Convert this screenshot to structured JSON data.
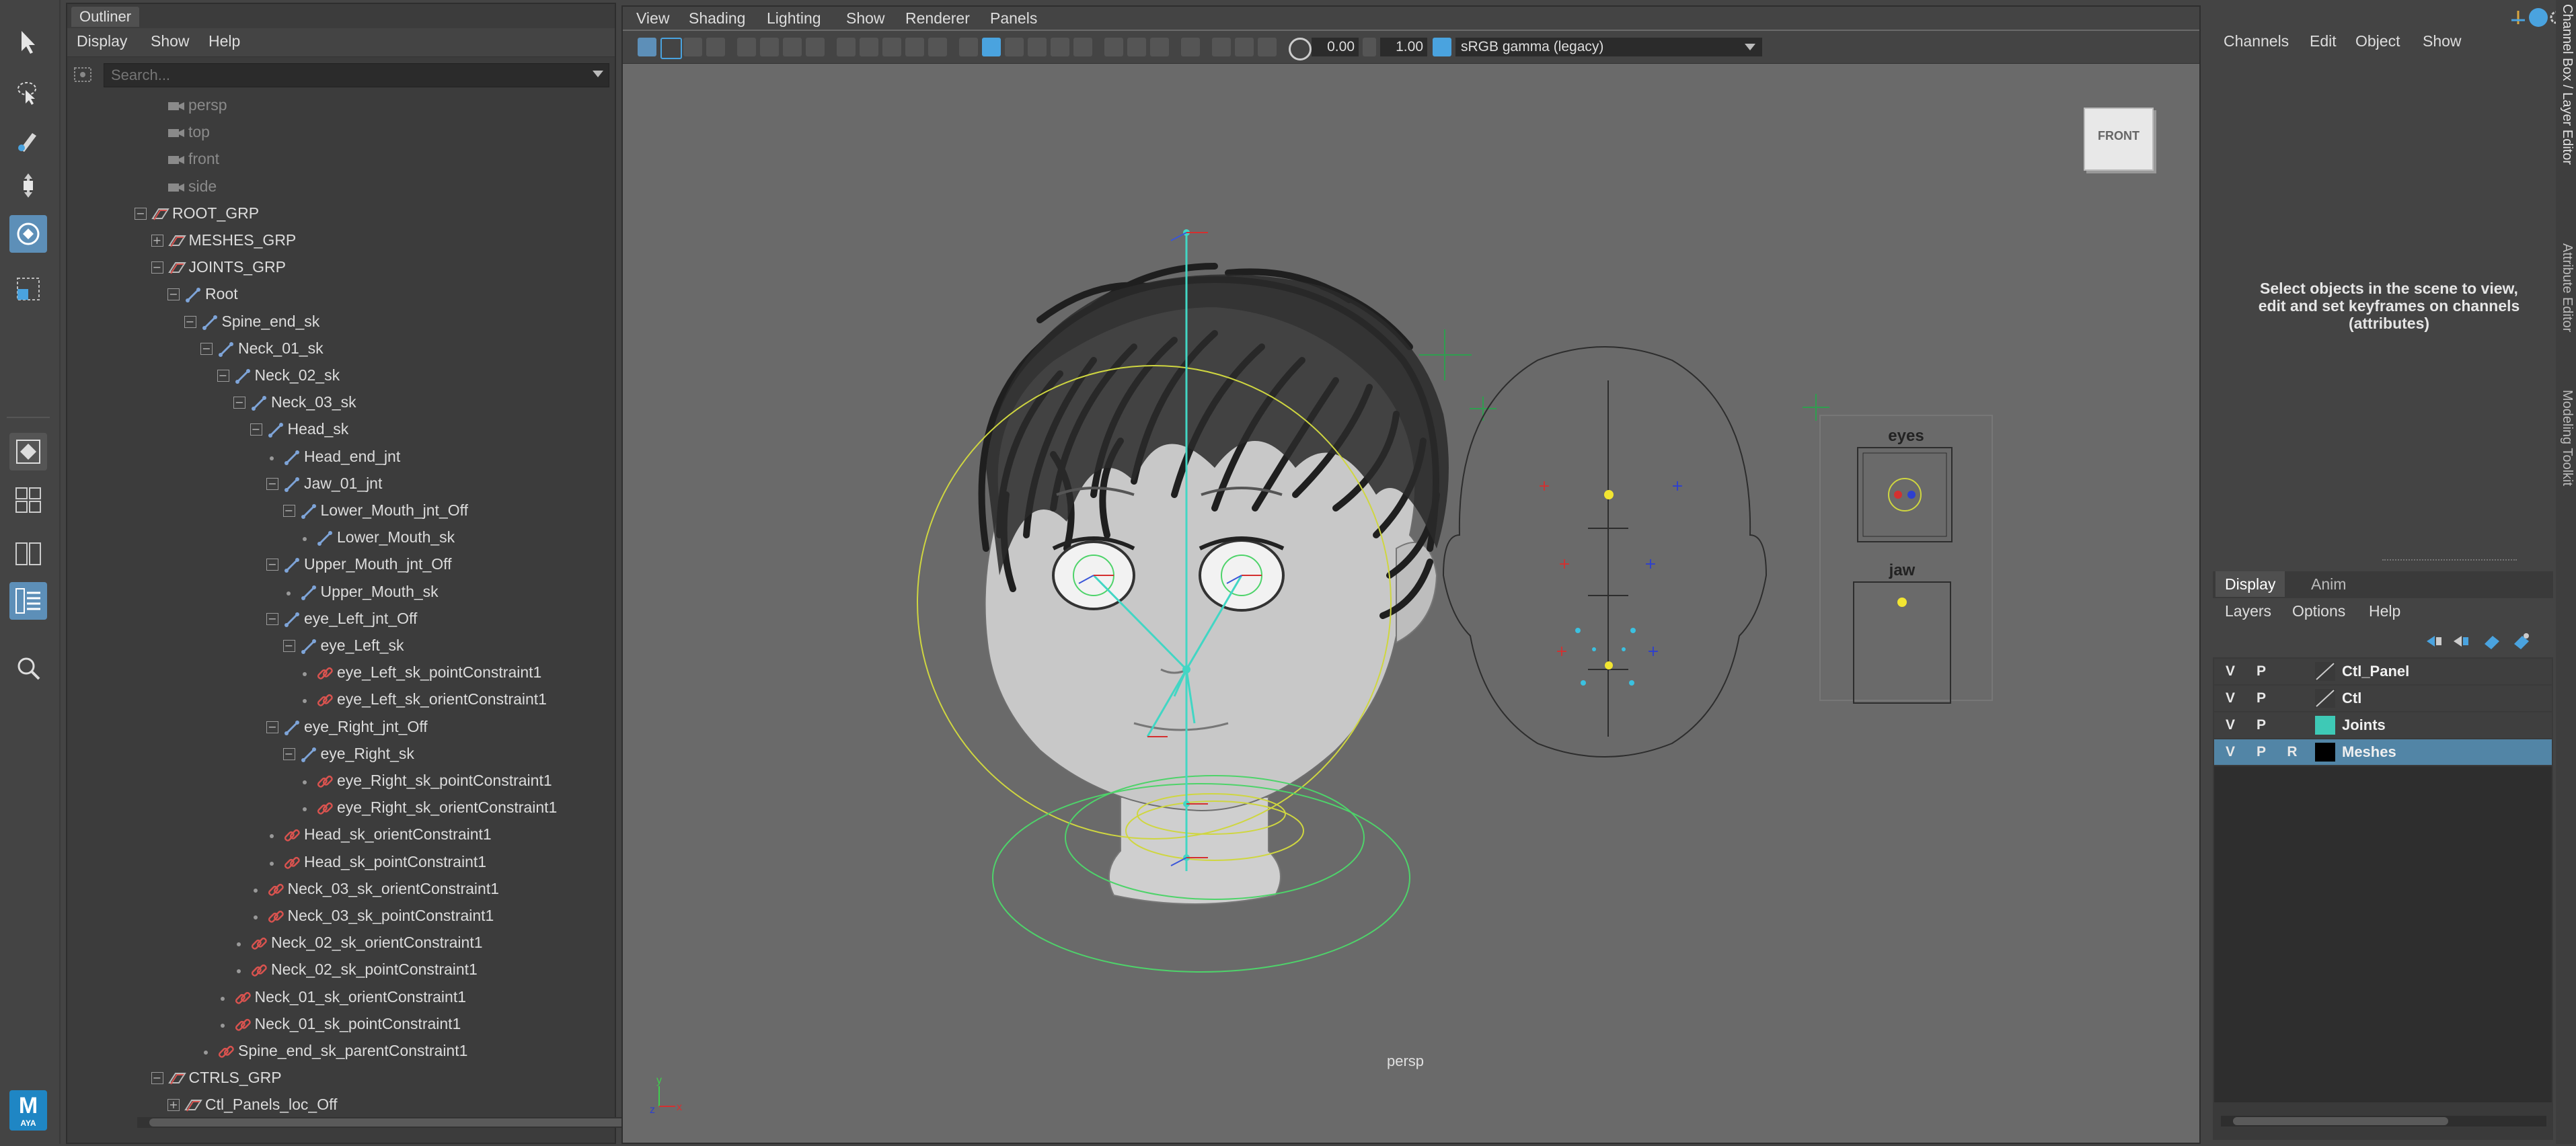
{
  "outliner": {
    "title": "Outliner",
    "menu": [
      "Display",
      "Show",
      "Help"
    ],
    "search_placeholder": "Search...",
    "items": [
      {
        "label": "persp",
        "depth": 0,
        "icon": "camera",
        "expander": "",
        "dim": true
      },
      {
        "label": "top",
        "depth": 0,
        "icon": "camera",
        "expander": "",
        "dim": true
      },
      {
        "label": "front",
        "depth": 0,
        "icon": "camera",
        "expander": "",
        "dim": true
      },
      {
        "label": "side",
        "depth": 0,
        "icon": "camera",
        "expander": "",
        "dim": true
      },
      {
        "label": "ROOT_GRP",
        "depth": 0,
        "icon": "group",
        "expander": "-"
      },
      {
        "label": "MESHES_GRP",
        "depth": 1,
        "icon": "group",
        "expander": "+"
      },
      {
        "label": "JOINTS_GRP",
        "depth": 1,
        "icon": "group",
        "expander": "-"
      },
      {
        "label": "Root",
        "depth": 2,
        "icon": "joint",
        "expander": "-"
      },
      {
        "label": "Spine_end_sk",
        "depth": 3,
        "icon": "joint",
        "expander": "-"
      },
      {
        "label": "Neck_01_sk",
        "depth": 4,
        "icon": "joint",
        "expander": "-"
      },
      {
        "label": "Neck_02_sk",
        "depth": 5,
        "icon": "joint",
        "expander": "-"
      },
      {
        "label": "Neck_03_sk",
        "depth": 6,
        "icon": "joint",
        "expander": "-"
      },
      {
        "label": "Head_sk",
        "depth": 7,
        "icon": "joint",
        "expander": "-"
      },
      {
        "label": "Head_end_jnt",
        "depth": 8,
        "icon": "joint",
        "expander": "dot"
      },
      {
        "label": "Jaw_01_jnt",
        "depth": 8,
        "icon": "joint",
        "expander": "-"
      },
      {
        "label": "Lower_Mouth_jnt_Off",
        "depth": 9,
        "icon": "joint",
        "expander": "-"
      },
      {
        "label": "Lower_Mouth_sk",
        "depth": 10,
        "icon": "joint",
        "expander": "dot"
      },
      {
        "label": "Upper_Mouth_jnt_Off",
        "depth": 8,
        "icon": "joint",
        "expander": "-"
      },
      {
        "label": "Upper_Mouth_sk",
        "depth": 9,
        "icon": "joint",
        "expander": "dot"
      },
      {
        "label": "eye_Left_jnt_Off",
        "depth": 8,
        "icon": "joint",
        "expander": "-"
      },
      {
        "label": "eye_Left_sk",
        "depth": 9,
        "icon": "joint",
        "expander": "-"
      },
      {
        "label": "eye_Left_sk_pointConstraint1",
        "depth": 10,
        "icon": "constraint",
        "expander": "dot"
      },
      {
        "label": "eye_Left_sk_orientConstraint1",
        "depth": 10,
        "icon": "constraint",
        "expander": "dot"
      },
      {
        "label": "eye_Right_jnt_Off",
        "depth": 8,
        "icon": "joint",
        "expander": "-"
      },
      {
        "label": "eye_Right_sk",
        "depth": 9,
        "icon": "joint",
        "expander": "-"
      },
      {
        "label": "eye_Right_sk_pointConstraint1",
        "depth": 10,
        "icon": "constraint",
        "expander": "dot"
      },
      {
        "label": "eye_Right_sk_orientConstraint1",
        "depth": 10,
        "icon": "constraint",
        "expander": "dot"
      },
      {
        "label": "Head_sk_orientConstraint1",
        "depth": 8,
        "icon": "constraint",
        "expander": "dot"
      },
      {
        "label": "Head_sk_pointConstraint1",
        "depth": 8,
        "icon": "constraint",
        "expander": "dot"
      },
      {
        "label": "Neck_03_sk_orientConstraint1",
        "depth": 7,
        "icon": "constraint",
        "expander": "dot"
      },
      {
        "label": "Neck_03_sk_pointConstraint1",
        "depth": 7,
        "icon": "constraint",
        "expander": "dot"
      },
      {
        "label": "Neck_02_sk_orientConstraint1",
        "depth": 6,
        "icon": "constraint",
        "expander": "dot"
      },
      {
        "label": "Neck_02_sk_pointConstraint1",
        "depth": 6,
        "icon": "constraint",
        "expander": "dot"
      },
      {
        "label": "Neck_01_sk_orientConstraint1",
        "depth": 5,
        "icon": "constraint",
        "expander": "dot"
      },
      {
        "label": "Neck_01_sk_pointConstraint1",
        "depth": 5,
        "icon": "constraint",
        "expander": "dot"
      },
      {
        "label": "Spine_end_sk_parentConstraint1",
        "depth": 4,
        "icon": "constraint",
        "expander": "dot"
      },
      {
        "label": "CTRLS_GRP",
        "depth": 1,
        "icon": "group",
        "expander": "-"
      },
      {
        "label": "Ctl_Panels_loc_Off",
        "depth": 2,
        "icon": "group",
        "expander": "+"
      }
    ]
  },
  "viewport": {
    "menu": [
      "View",
      "Shading",
      "Lighting",
      "Show",
      "Renderer",
      "Panels"
    ],
    "exposure_value": "0.00",
    "gamma_value": "1.00",
    "color_space": "sRGB gamma (legacy)",
    "camera_label": "persp",
    "view_cube_label": "FRONT",
    "panel_labels": {
      "eyes": "eyes",
      "jaw": "jaw"
    },
    "axis": {
      "y": "y",
      "x": "x",
      "z": "z"
    }
  },
  "channel_box": {
    "menu": [
      "Channels",
      "Edit",
      "Object",
      "Show"
    ],
    "message": "Select objects in the scene to view, edit and set keyframes on channels (attributes)"
  },
  "side_tabs": [
    "Channel Box / Layer Editor",
    "Attribute Editor",
    "Modeling Toolkit"
  ],
  "layer_editor": {
    "tabs": [
      "Display",
      "Anim"
    ],
    "menu": [
      "Layers",
      "Options",
      "Help"
    ],
    "layers": [
      {
        "v": "V",
        "p": "P",
        "r": "",
        "name": "Ctl_Panel",
        "swatch": "diag",
        "selected": false
      },
      {
        "v": "V",
        "p": "P",
        "r": "",
        "name": "Ctl",
        "swatch": "diag",
        "selected": false
      },
      {
        "v": "V",
        "p": "P",
        "r": "",
        "name": "Joints",
        "swatch": "#3ec9b6",
        "selected": false
      },
      {
        "v": "V",
        "p": "P",
        "r": "R",
        "name": "Meshes",
        "swatch": "#000000",
        "selected": true
      }
    ]
  },
  "maya_logo": {
    "letter": "M",
    "text": "AYA"
  },
  "colors": {
    "accent": "#5285a6",
    "active_tool": "#5d8fb8",
    "viewport_bg": "#6a6a6a",
    "joint_icon": "#7ea4d8",
    "constraint_icon": "#d9534f"
  }
}
